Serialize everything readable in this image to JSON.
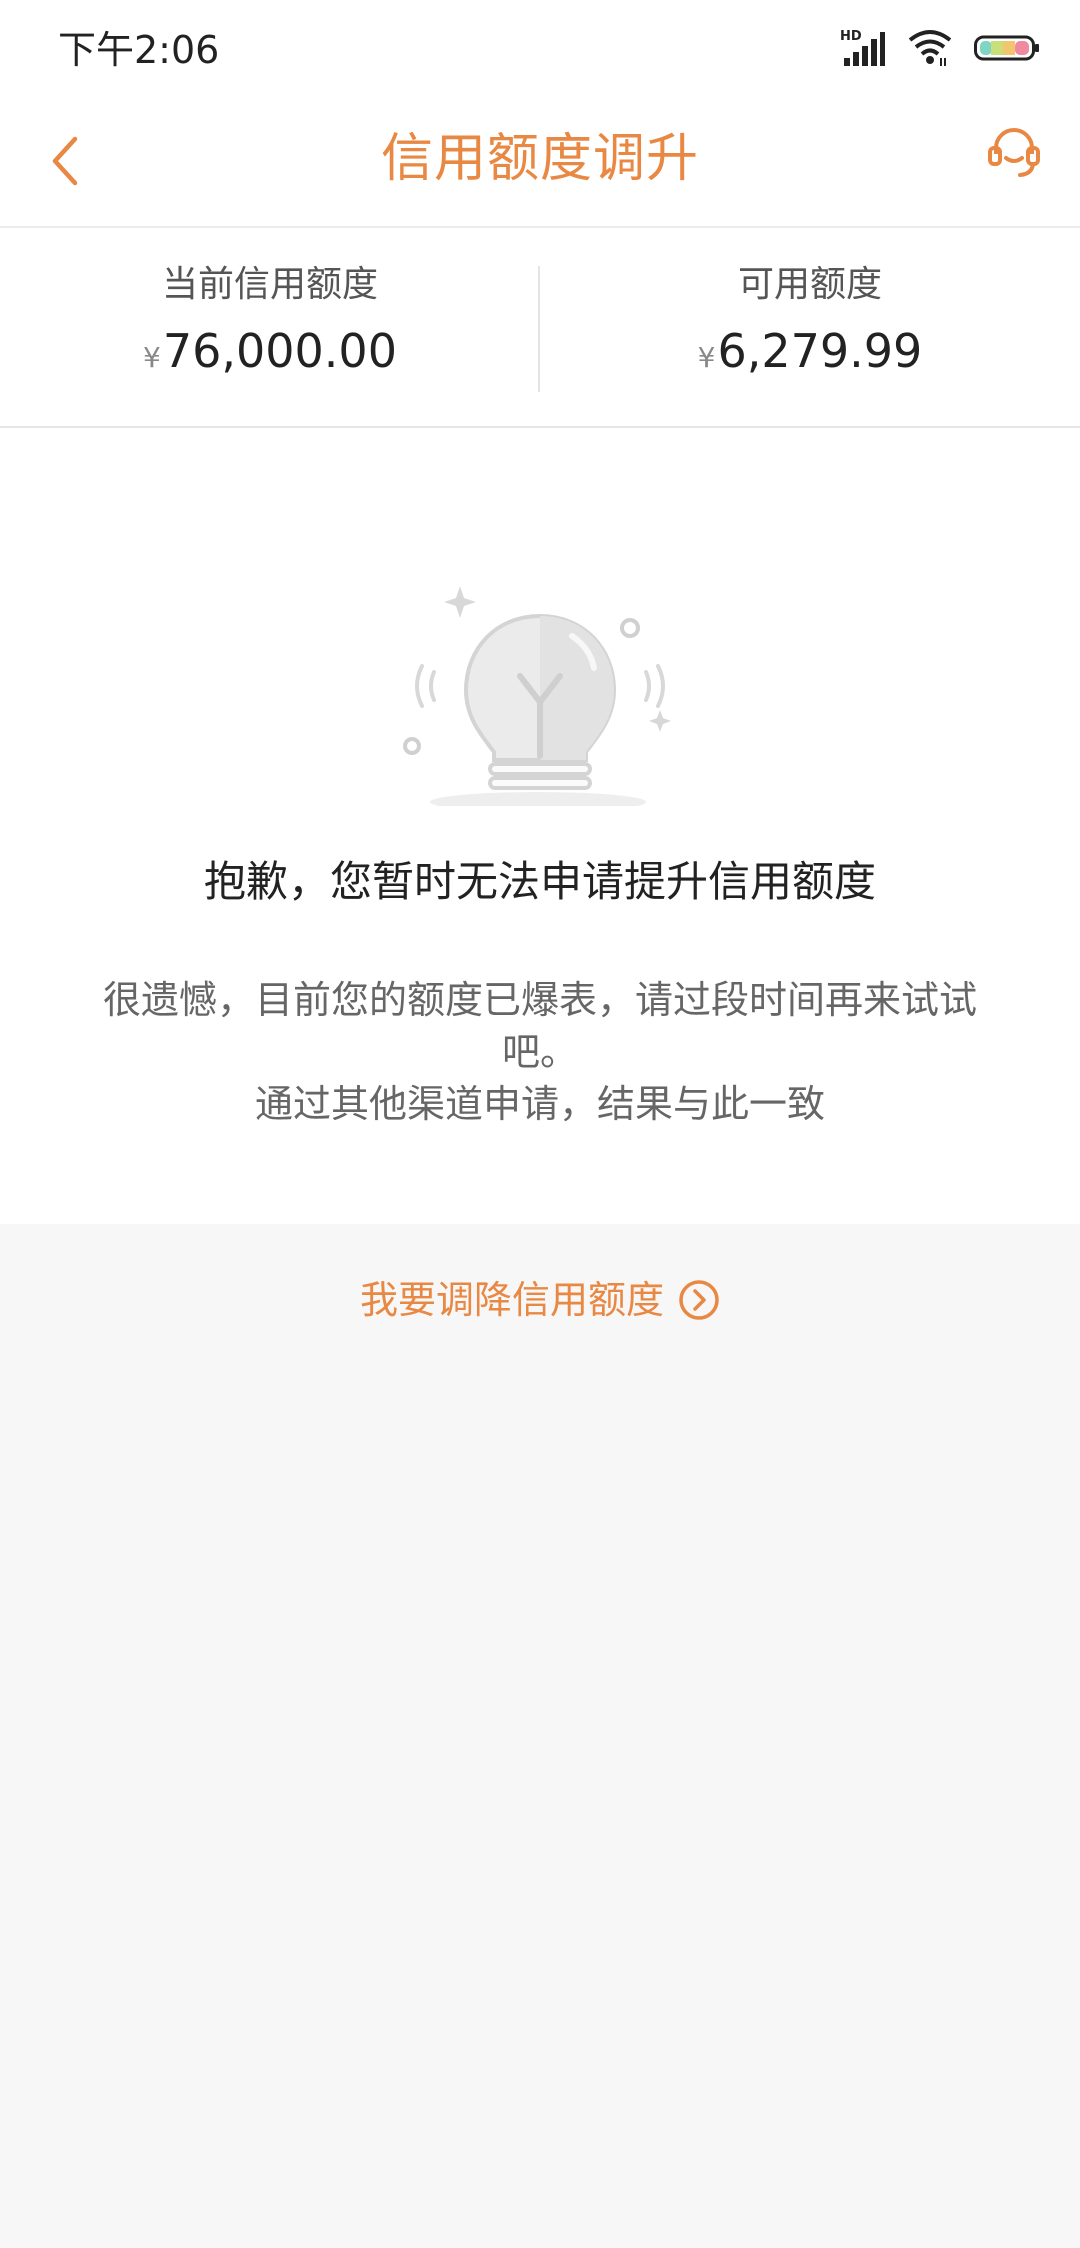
{
  "status_bar": {
    "time": "下午2:06",
    "network_label": "HD"
  },
  "nav": {
    "title": "信用额度调升",
    "back_icon": "chevron-left-icon",
    "service_icon": "customer-service-icon",
    "accent_color": "#e88843"
  },
  "summary": {
    "current": {
      "label": "当前信用额度",
      "currency": "¥",
      "amount": "76,000.00"
    },
    "available": {
      "label": "可用额度",
      "currency": "¥",
      "amount": "6,279.99"
    }
  },
  "message": {
    "illustration_icon": "lightbulb-icon",
    "title": "抱歉，您暂时无法申请提升信用额度",
    "description_line1": "很遗憾，目前您的额度已爆表，请过段时间再来试试吧。",
    "description_line2": "通过其他渠道申请，结果与此一致"
  },
  "reduce_link": {
    "label": "我要调降信用额度",
    "icon": "circle-chevron-right-icon"
  }
}
